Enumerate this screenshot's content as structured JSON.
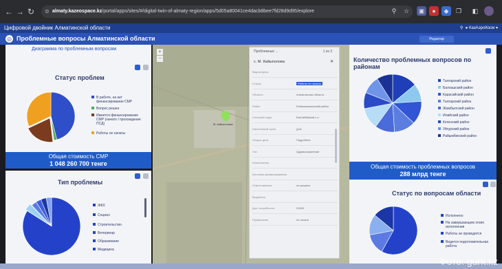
{
  "browser": {
    "url_host": "almaty.kazeospace.kz",
    "url_path": "/portal/apps/sites/#/digital-twin-of-almaty-region/apps/5d05a80041ce4dacb8bee7fd28d9d95/explore"
  },
  "app": {
    "title": "Цифровой двойник Алматинской области",
    "user_label": "КазАэроКосм",
    "subtitle": "Проблемные вопросы Алматинской области",
    "editor_button": "Редактор"
  },
  "left_top": {
    "header": "Диаграмма по проблемным вопросам",
    "title": "Статус проблем",
    "legend": [
      {
        "label": "В работе, на акт финансирования СМР",
        "color": "#2e4fc9"
      },
      {
        "label": "Вопрос решен",
        "color": "#4caf50"
      },
      {
        "label": "Имеется финансирование СМР (начато / прохождение ПСД)",
        "color": "#7a3b1e"
      },
      {
        "label": "Работы не начаты",
        "color": "#f0a020"
      }
    ],
    "sum_label": "Общая стоимость СМР",
    "sum_value": "1 048 260 700 тенге"
  },
  "left_bottom": {
    "title": "Тип проблемы",
    "legend": [
      "ЖКХ",
      "Социал",
      "Строительство",
      "Ветеринар",
      "Образование",
      "Медицина"
    ]
  },
  "popup": {
    "header": "Проблемные ...",
    "counter": "1 из 3",
    "subtitle": "с. М. Кайыполова",
    "fields": [
      {
        "k": "Вид вопроса",
        "v": ""
      },
      {
        "k": "Статус",
        "v": "Работы не начаты"
      },
      {
        "k": "Область",
        "v": "Алматинская область"
      },
      {
        "k": "Район",
        "v": "Енбекшиказахский район"
      },
      {
        "k": "Сельский округ",
        "v": "Балтабайский с.о."
      },
      {
        "k": "Населенный пункт",
        "v": "Д.Ш."
      },
      {
        "k": "Открыт дата",
        "v": "Подробнее"
      },
      {
        "k": "Тип",
        "v": "Здравоохранение"
      },
      {
        "k": "Исполнитель",
        "v": ""
      },
      {
        "k": "Источник финансирования",
        "v": ""
      },
      {
        "k": "Ответственные",
        "v": "не указано"
      },
      {
        "k": "Выделено",
        "v": ""
      },
      {
        "k": "Доп. потребность",
        "v": "20000"
      },
      {
        "k": "Примечание",
        "v": "не начато"
      }
    ]
  },
  "right_top": {
    "title": "Количество проблемных вопросов по районам",
    "legend": [
      "Талгарский район",
      "Балхашский район",
      "Карасайский район",
      "Талгарский район",
      "Жамбылский район",
      "Илийский район",
      "Кегенский район",
      "Уйгурский район",
      "Райымбекский район"
    ],
    "sum_label": "Общая стоимость проблемных вопросов",
    "sum_value": "288 млрд тенге"
  },
  "right_bottom": {
    "title": "Статус по вопросам области",
    "legend": [
      "Исполнено",
      "На завершающем этапе исполнения",
      "Работы не проводятся",
      "Ведется подготовительная работа"
    ]
  },
  "map": {
    "marker_label": "М. Кайыполова"
  },
  "watermark": "Фото: gurk.kz",
  "chart_data": [
    {
      "type": "pie",
      "title": "Статус проблем",
      "categories": [
        "В работе, на акт финансирования СМР",
        "Вопрос решен",
        "Имеется финансирование СМР (начато / прохождение ПСД)",
        "Работы не начаты"
      ],
      "values": [
        46,
        2,
        20,
        32
      ],
      "colors": [
        "#2e4fc9",
        "#4caf50",
        "#7a3b1e",
        "#f0a020"
      ]
    },
    {
      "type": "pie",
      "title": "Тип проблемы",
      "categories": [
        "ЖКХ",
        "Социал",
        "Строительство",
        "Ветеринар",
        "Образование",
        "Медицина"
      ],
      "values": [
        84,
        4,
        3,
        3,
        3,
        3
      ],
      "colors": [
        "#2442c9",
        "#9fd2f2",
        "#5b7be3",
        "#3d5fd8",
        "#1c36a8",
        "#7fa2ee"
      ]
    },
    {
      "type": "pie",
      "title": "Количество проблемных вопросов по районам",
      "categories": [
        "Талгарский район",
        "Балхашский район",
        "Карасайский район",
        "Талгарский район",
        "Жамбылский район",
        "Илийский район",
        "Кегенский район",
        "Уйгурский район",
        "Райымбекский район"
      ],
      "values": [
        14,
        10,
        13,
        12,
        11,
        12,
        9,
        10,
        9
      ],
      "colors": [
        "#1e3fb8",
        "#8ec8ef",
        "#3155d4",
        "#5c7de0",
        "#4a6bd9",
        "#b6dcf6",
        "#2a4ac6",
        "#6f94e8",
        "#1a3296"
      ]
    },
    {
      "type": "pie",
      "title": "Статус по вопросам области",
      "categories": [
        "Исполнено",
        "На завершающем этапе исполнения",
        "Работы не проводятся",
        "Ведется подготовительная работа"
      ],
      "values": [
        58,
        14,
        14,
        14
      ],
      "colors": [
        "#2442c9",
        "#5b7be3",
        "#8ab0ef",
        "#1c36a8"
      ]
    }
  ]
}
